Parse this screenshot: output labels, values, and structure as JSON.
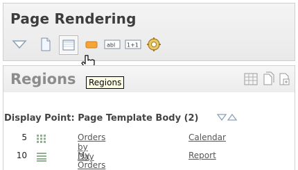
{
  "header": {
    "title": "Page Rendering"
  },
  "toolbar": {
    "icons": [
      "triangle-down-icon",
      "page-icon",
      "region-icon",
      "button-icon",
      "text-item-icon",
      "computation-icon",
      "process-gear-icon"
    ]
  },
  "regions": {
    "title": "Regions",
    "tooltip": "Regions",
    "display_point": {
      "label": "Display Point: Page Template Body (2)"
    },
    "rows": [
      {
        "sequence": "5",
        "name": "Orders by Day",
        "type": "Calendar",
        "icon": "calendar-grid-icon"
      },
      {
        "sequence": "10",
        "name": "My Orders",
        "type": "Report",
        "icon": "report-lines-icon"
      }
    ]
  }
}
